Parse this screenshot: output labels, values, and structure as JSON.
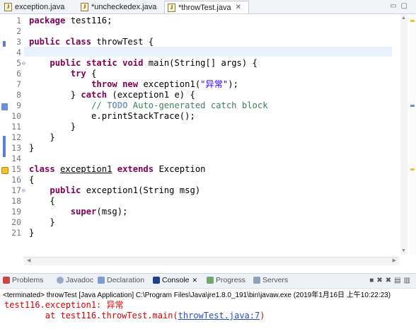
{
  "tabs": [
    {
      "label": "exception.java",
      "active": false,
      "closable": false
    },
    {
      "label": "*uncheckedex.java",
      "active": false,
      "closable": false
    },
    {
      "label": "*throwTest.java",
      "active": true,
      "closable": true
    }
  ],
  "tab_close_glyph": "✕",
  "window_controls": [
    "minimize",
    "maximize"
  ],
  "editor": {
    "current_line": 4,
    "lines": [
      {
        "n": "1",
        "html": "<span class=\"kw\">package</span> test116;"
      },
      {
        "n": "2",
        "html": ""
      },
      {
        "n": "3",
        "html": "<span class=\"kw\">public</span> <span class=\"kw\">class</span> throwTest {"
      },
      {
        "n": "4",
        "html": ""
      },
      {
        "n": "5",
        "html": "    <span class=\"kw\">public</span> <span class=\"kw\">static</span> <span class=\"kw\">void</span> main(String[] args) {"
      },
      {
        "n": "6",
        "html": "        <span class=\"kw\">try</span> {"
      },
      {
        "n": "7",
        "html": "            <span class=\"kw\">throw</span> <span class=\"kw\">new</span> exception1(<span class=\"str\">\"异常\"</span>);"
      },
      {
        "n": "8",
        "html": "        } <span class=\"kw\">catch</span> (exception1 e) {"
      },
      {
        "n": "9",
        "html": "            <span class=\"cmt\">// </span><span class=\"todo\">TODO</span><span class=\"cmt\"> Auto-generated catch block</span>"
      },
      {
        "n": "10",
        "html": "            e.printStackTrace();"
      },
      {
        "n": "11",
        "html": "        }"
      },
      {
        "n": "12",
        "html": "    }"
      },
      {
        "n": "13",
        "html": "}"
      },
      {
        "n": "14",
        "html": ""
      },
      {
        "n": "15",
        "html": "<span class=\"kw\">class</span> <span class=\"und\">exception1</span> <span class=\"kw\">extends</span> Exception"
      },
      {
        "n": "16",
        "html": "{"
      },
      {
        "n": "17",
        "html": "    <span class=\"kw\">public</span> exception1(String msg)"
      },
      {
        "n": "18",
        "html": "    {"
      },
      {
        "n": "19",
        "html": "        <span class=\"kw\">super</span>(msg);"
      },
      {
        "n": "20",
        "html": "    }"
      },
      {
        "n": "21",
        "html": "}"
      }
    ]
  },
  "panel": {
    "tabs": [
      {
        "label": "Problems",
        "icon": "problems-icon",
        "active": false
      },
      {
        "label": "Javadoc",
        "icon": "javadoc-icon",
        "active": false
      },
      {
        "label": "Declaration",
        "icon": "declaration-icon",
        "active": false
      },
      {
        "label": "Console",
        "icon": "console-icon",
        "active": true
      },
      {
        "label": "Progress",
        "icon": "progress-icon",
        "active": false
      },
      {
        "label": "Servers",
        "icon": "servers-icon",
        "active": false
      }
    ],
    "console_close_glyph": "✕",
    "terminated": "<terminated> throwTest [Java Application] C:\\Program Files\\Java\\jre1.8.0_191\\bin\\javaw.exe (2019年1月16日 上午10:22:23)",
    "output_line1": "test116.exception1: 异常",
    "output_line2_prefix": "\tat test116.throwTest.main(",
    "output_line2_link": "throwTest.java:7",
    "output_line2_suffix": ")"
  },
  "colors": {
    "keyword": "#7f0055",
    "string": "#2a00ff",
    "comment": "#3f7f5f",
    "error": "#dd0000",
    "link": "#2a4cc8"
  }
}
